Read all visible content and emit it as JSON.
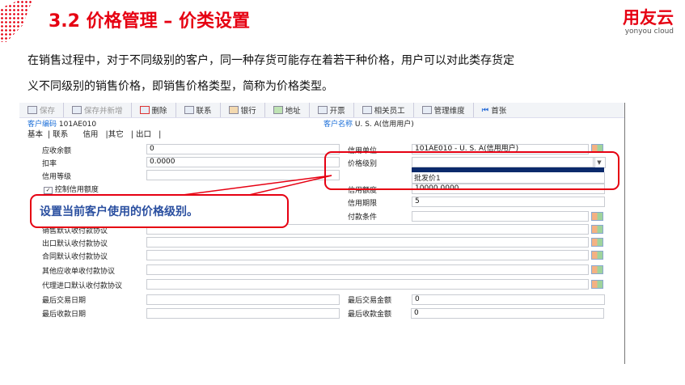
{
  "slide": {
    "title": "3.2  价格管理 – 价类设置",
    "logo_cn": "用友云",
    "logo_en": "yonyou cloud",
    "para1": "在销售过程中，对于不同级别的客户，同一种存货可能存在着若干种价格，用户可以对此类存货定",
    "para2": "义不同级别的销售价格，即销售价格类型，简称为价格类型。",
    "callout": "设置当前客户使用的价格级别。"
  },
  "toolbar": [
    {
      "label": "保存",
      "disabled": true
    },
    {
      "label": "保存并新增",
      "disabled": true
    },
    {
      "label": "删除"
    },
    {
      "label": "联系"
    },
    {
      "label": "银行"
    },
    {
      "label": "地址"
    },
    {
      "label": "开票"
    },
    {
      "label": "相关员工"
    },
    {
      "label": "管理维度"
    },
    {
      "label": "首张"
    }
  ],
  "header": {
    "code_label": "客户编码",
    "code": "101AE010",
    "name_label": "客户名称",
    "name": "U. S. A(信用用户)"
  },
  "tabs": [
    "基本",
    "联系",
    "信用",
    "其它",
    "出口"
  ],
  "active_tab": "信用",
  "left": {
    "ar_balance_label": "应收余额",
    "ar_balance": "0",
    "discount_label": "扣率",
    "discount": "0.0000",
    "credit_grade_label": "信用等级",
    "credit_grade": "",
    "control_credit_label": "控制信用额度",
    "control_credit": true,
    "sales_terms_label": "销售默认收付款协议",
    "export_terms_label": "出口默认收付款协议",
    "contract_terms_label": "合同默认收付款协议",
    "other_terms_label": "其他应收单收付款协议",
    "agent_terms_label": "代理进口默认收付款协议",
    "last_trade_date_label": "最后交易日期",
    "last_pay_date_label": "最后收款日期"
  },
  "right": {
    "credit_unit_label": "信用单位",
    "credit_unit": "101AE010 - U. S. A(信用用户)",
    "price_level_label": "价格级别",
    "price_level": "",
    "price_level_options": [
      "",
      "批发价1"
    ],
    "credit_limit_label": "信用额度",
    "credit_limit": "10000.0000",
    "credit_period_label": "信用期限",
    "credit_period": "5",
    "pay_terms_label": "付款条件",
    "pay_terms": "",
    "last_trade_amount_label": "最后交易金额",
    "last_trade_amount": "0",
    "last_pay_amount_label": "最后收款金额",
    "last_pay_amount": "0"
  },
  "colors": {
    "brand_red": "#e60012",
    "callout_text": "#2a4fa0",
    "selected": "#0b2a6b"
  }
}
